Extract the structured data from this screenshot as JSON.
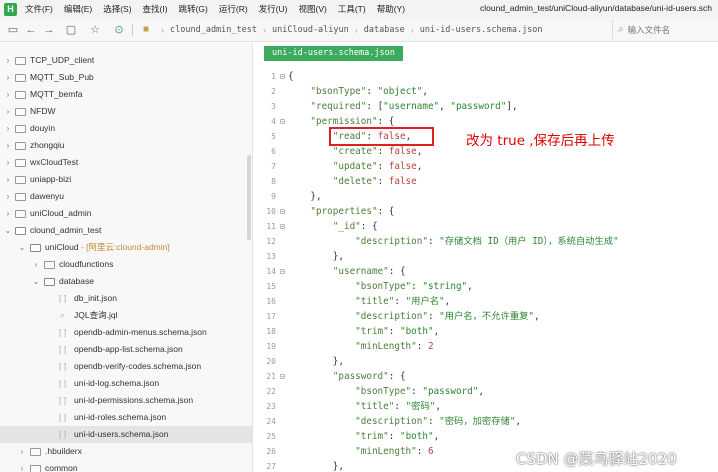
{
  "menubar": {
    "logo": "H",
    "items": [
      "文件(F)",
      "编辑(E)",
      "选择(S)",
      "查找(I)",
      "跳转(G)",
      "运行(R)",
      "发行(U)",
      "视图(V)",
      "工具(T)",
      "帮助(Y)"
    ],
    "window_title": "clound_admin_test/uniCloud-aliyun/database/uni-id-users.sch"
  },
  "toolbar": {
    "breadcrumb": [
      "clound_admin_test",
      "uniCloud-aliyun",
      "database",
      "uni-id-users.schema.json"
    ],
    "search_placeholder": "输入文件名"
  },
  "sidebar": {
    "items": [
      {
        "label": "TCP_UDP_client"
      },
      {
        "label": "MQTT_Sub_Pub"
      },
      {
        "label": "MQTT_bemfa"
      },
      {
        "label": "NFDW"
      },
      {
        "label": "douyin"
      },
      {
        "label": "zhongqiu"
      },
      {
        "label": "wxCloudTest"
      },
      {
        "label": "uniapp-bizi"
      },
      {
        "label": "dawenyu"
      },
      {
        "label": "uniCloud_admin"
      },
      {
        "label": "clound_admin_test"
      },
      {
        "label": "uniCloud",
        "tag": " - [阿里云:clound-admin]"
      },
      {
        "label": "cloudfunctions"
      },
      {
        "label": "database"
      },
      {
        "label": "db_init.json"
      },
      {
        "label": "JQL查询.jql"
      },
      {
        "label": "opendb-admin-menus.schema.json"
      },
      {
        "label": "opendb-app-list.schema.json"
      },
      {
        "label": "opendb-verify-codes.schema.json"
      },
      {
        "label": "uni-id-log.schema.json"
      },
      {
        "label": "uni-id-permissions.schema.json"
      },
      {
        "label": "uni-id-roles.schema.json"
      },
      {
        "label": "uni-id-users.schema.json"
      },
      {
        "label": ".hbuilderx"
      },
      {
        "label": "common"
      }
    ]
  },
  "editor": {
    "tab": "uni-id-users.schema.json",
    "annotation": "改为 true ,保存后再上传",
    "watermark": "CSDN @菜鸟驿站2020"
  }
}
